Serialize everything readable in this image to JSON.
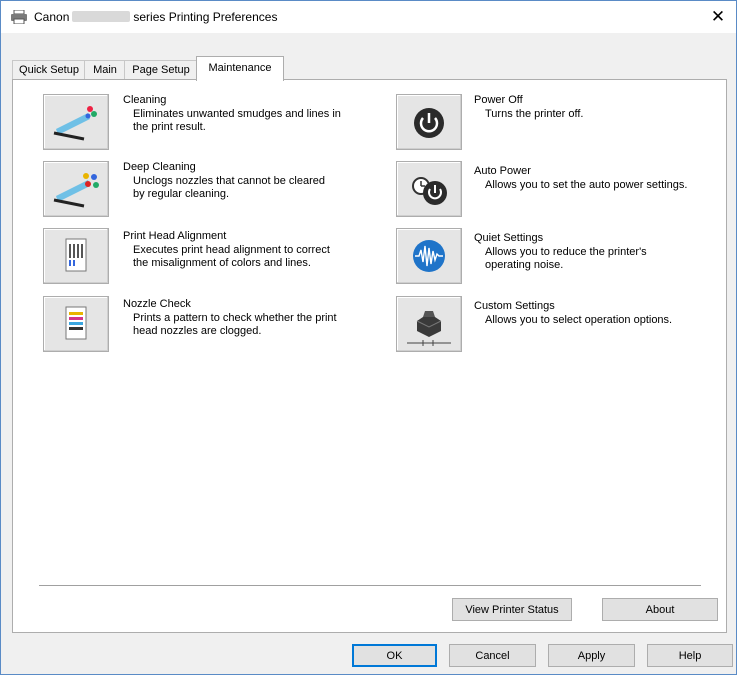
{
  "window": {
    "title_prefix": "Canon",
    "title_suffix": "series Printing Preferences",
    "close_glyph": "✕"
  },
  "tabs": [
    "Quick Setup",
    "Main",
    "Page Setup",
    "Maintenance"
  ],
  "active_tab": "Maintenance",
  "tools_left": [
    {
      "title": "Cleaning",
      "desc": [
        "Eliminates unwanted smudges and lines in",
        "the print result."
      ],
      "icon": "cleaning-icon"
    },
    {
      "title": "Deep Cleaning",
      "desc": [
        "Unclogs nozzles that cannot be cleared",
        "by regular cleaning."
      ],
      "icon": "deep-cleaning-icon"
    },
    {
      "title": "Print Head Alignment",
      "desc": [
        "Executes print head alignment to correct",
        "the misalignment of colors and lines."
      ],
      "icon": "print-head-alignment-icon"
    },
    {
      "title": "Nozzle Check",
      "desc": [
        "Prints a pattern to check whether the print",
        "head nozzles are clogged."
      ],
      "icon": "nozzle-check-icon"
    }
  ],
  "tools_right": [
    {
      "title": "Power Off",
      "desc": [
        "Turns the printer off."
      ],
      "icon": "power-off-icon"
    },
    {
      "title": "Auto Power",
      "desc": [
        "Allows you to set the auto power settings."
      ],
      "icon": "auto-power-icon"
    },
    {
      "title": "Quiet Settings",
      "desc": [
        "Allows you to reduce the printer's",
        "operating noise."
      ],
      "icon": "quiet-settings-icon"
    },
    {
      "title": "Custom Settings",
      "desc": [
        "Allows you to select operation options."
      ],
      "icon": "custom-settings-icon"
    }
  ],
  "panel_buttons": {
    "view_printer_status": "View Printer Status",
    "about": "About"
  },
  "dialog_buttons": {
    "ok": "OK",
    "cancel": "Cancel",
    "apply": "Apply",
    "help": "Help"
  }
}
